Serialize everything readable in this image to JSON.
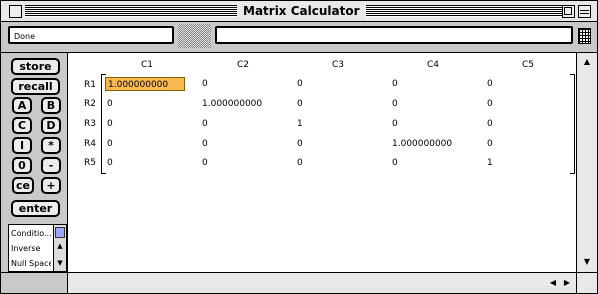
{
  "window": {
    "title": "Matrix Calculator"
  },
  "toolbar": {
    "status": "Done",
    "entry_value": ""
  },
  "sidebar": {
    "store": "store",
    "recall": "recall",
    "keys": [
      "A",
      "B",
      "C",
      "D",
      "I",
      "*",
      "0",
      "-",
      "ce",
      "+"
    ],
    "enter": "enter",
    "operations": [
      "Conditio...",
      "Inverse",
      "Null Space"
    ]
  },
  "matrix": {
    "columns": [
      "C1",
      "C2",
      "C3",
      "C4",
      "C5"
    ],
    "rows": [
      "R1",
      "R2",
      "R3",
      "R4",
      "R5"
    ],
    "cells": [
      [
        "1.000000000",
        "0",
        "0",
        "0",
        "0"
      ],
      [
        "0",
        "1.000000000",
        "0",
        "0",
        "0"
      ],
      [
        "0",
        "0",
        "1",
        "0",
        "0"
      ],
      [
        "0",
        "0",
        "0",
        "1.000000000",
        "0"
      ],
      [
        "0",
        "0",
        "0",
        "0",
        "1"
      ]
    ],
    "selected": "R1C1"
  },
  "icons": {
    "close": "close-box-icon",
    "zoom": "zoom-box-icon",
    "collapse": "collapse-box-icon",
    "grid": "grid-view-icon",
    "scroll_up": "arrow-up-icon",
    "scroll_down": "arrow-down-icon",
    "scroll_left": "arrow-left-icon",
    "scroll_right": "arrow-right-icon",
    "list_menu": "list-lines-icon"
  },
  "colors": {
    "selection": "#f7b94f",
    "scroll_thumb": "#9da6ff",
    "panel": "#c9c9c9"
  }
}
